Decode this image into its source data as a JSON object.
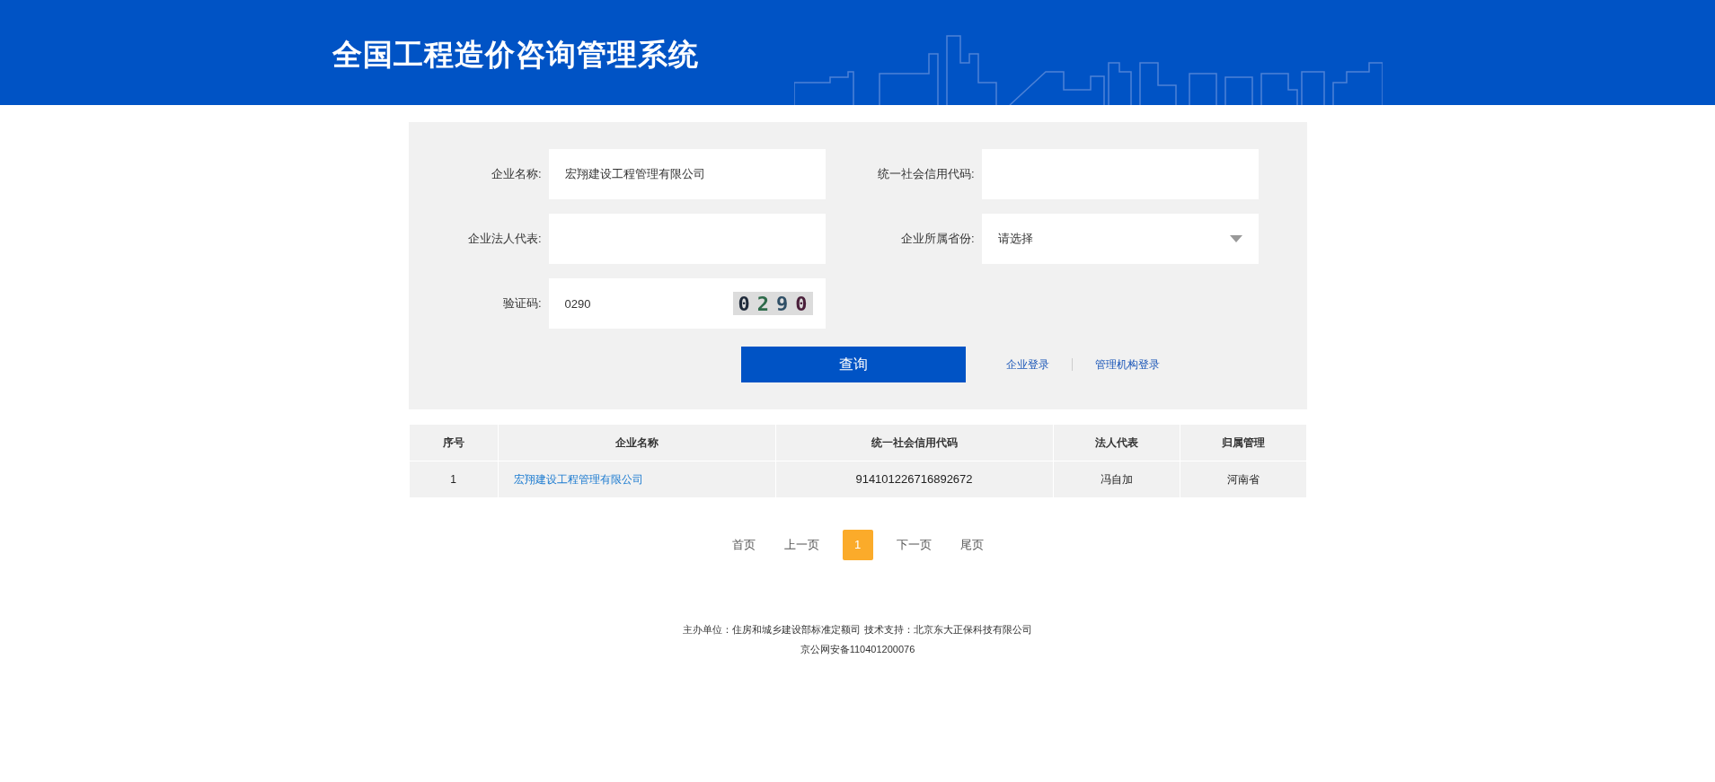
{
  "header": {
    "title": "全国工程造价咨询管理系统"
  },
  "form": {
    "fields": [
      {
        "kind": "text",
        "label": "企业名称:",
        "value": "宏翔建设工程管理有限公司"
      },
      {
        "kind": "text",
        "label": "统一社会信用代码:"
      },
      {
        "kind": "text",
        "label": "企业法人代表:"
      },
      {
        "kind": "select",
        "label": "企业所属省份:",
        "value": "请选择"
      },
      {
        "kind": "captcha",
        "label": "验证码:",
        "value": "0290",
        "captcha": [
          {
            "char": "0",
            "color": "#1f2a3a"
          },
          {
            "char": "2",
            "color": "#2e6b4a"
          },
          {
            "char": "9",
            "color": "#2f4f66"
          },
          {
            "char": "0",
            "color": "#4a1f3a"
          }
        ]
      }
    ],
    "submit": "查询",
    "links": [
      "企业登录",
      "管理机构登录"
    ]
  },
  "table": {
    "columns": [
      "序号",
      "企业名称",
      "统一社会信用代码",
      "法人代表",
      "归属管理"
    ],
    "rows": [
      [
        "1",
        "宏翔建设工程管理有限公司",
        "914101226716892672",
        "冯自加",
        "河南省"
      ]
    ]
  },
  "pagination": [
    {
      "label": "首页",
      "selected": false
    },
    {
      "label": "上一页",
      "selected": false
    },
    {
      "label": "1",
      "selected": true
    },
    {
      "label": "下一页",
      "selected": false
    },
    {
      "label": "尾页",
      "selected": false
    }
  ],
  "footer": [
    "主办单位：住房和城乡建设部标准定额司 技术支持：北京东大正保科技有限公司",
    "京公网安备110401200076"
  ]
}
